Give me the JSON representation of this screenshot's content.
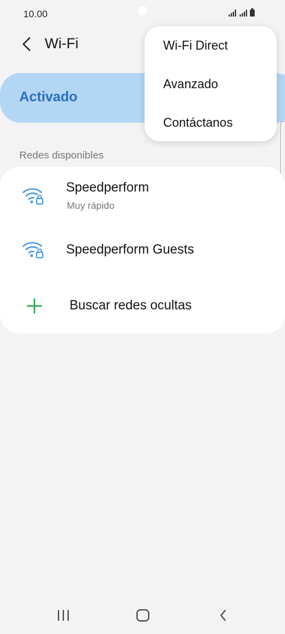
{
  "status_bar": {
    "time": "10.00"
  },
  "header": {
    "title": "Wi-Fi"
  },
  "toggle": {
    "label": "Activado"
  },
  "networks": {
    "section_title": "Redes disponibles",
    "items": [
      {
        "name": "Speedperform",
        "subtitle": "Muy rápido"
      },
      {
        "name": "Speedperform Guests",
        "subtitle": ""
      }
    ],
    "add_label": "Buscar redes ocultas"
  },
  "menu": {
    "items": [
      "Wi-Fi Direct",
      "Avanzado",
      "Contáctanos"
    ]
  },
  "colors": {
    "accent": "#2a6fbd",
    "toggle_bg": "#b3d6f5",
    "wifi_icon": "#4a9be0",
    "add_icon": "#2fa74f"
  }
}
